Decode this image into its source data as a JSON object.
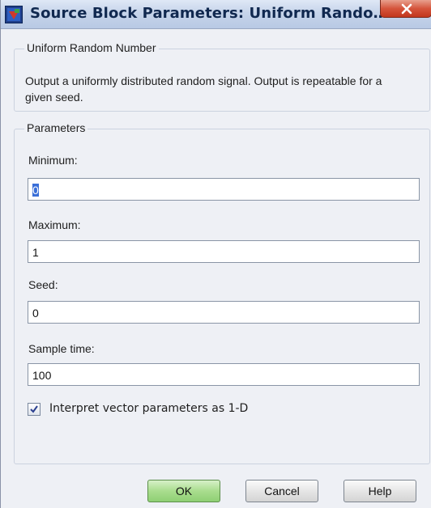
{
  "window": {
    "title": "Source Block Parameters: Uniform Rando…"
  },
  "block": {
    "group_title": "Uniform Random Number",
    "description": "Output a uniformly distributed random signal.  Output is repeatable for a given seed."
  },
  "parameters": {
    "group_title": "Parameters",
    "minimum": {
      "label": "Minimum:",
      "value": "0"
    },
    "maximum": {
      "label": "Maximum:",
      "value": "1"
    },
    "seed": {
      "label": "Seed:",
      "value": "0"
    },
    "sample_time": {
      "label": "Sample time:",
      "value": "100"
    },
    "interpret_vector": {
      "label": "Interpret vector parameters as 1-D",
      "checked": true
    }
  },
  "buttons": {
    "ok": "OK",
    "cancel": "Cancel",
    "help": "Help"
  },
  "icons": {
    "app": "simulink-block-icon",
    "close": "close-icon",
    "check": "checkmark-icon"
  },
  "colors": {
    "title_text": "#10284f",
    "close_button": "#d5553c",
    "ok_button": "#a9dd8e",
    "selection": "#3a6fd8"
  }
}
